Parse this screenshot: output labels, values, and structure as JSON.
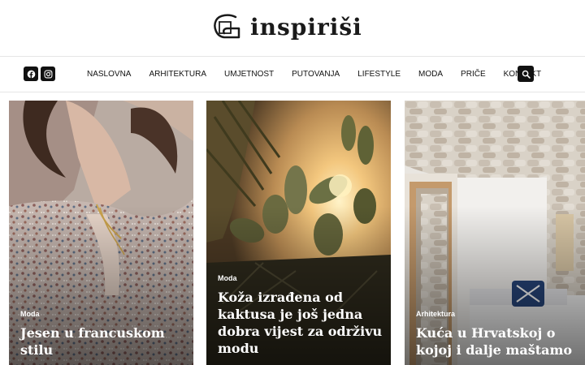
{
  "site": {
    "logo_text": "inspiriši"
  },
  "social": {
    "facebook_icon": "facebook-icon",
    "instagram_icon": "instagram-icon"
  },
  "nav": {
    "items": [
      {
        "label": "NASLOVNA"
      },
      {
        "label": "ARHITEKTURA"
      },
      {
        "label": "UMJETNOST"
      },
      {
        "label": "PUTOVANJA"
      },
      {
        "label": "LIFESTYLE"
      },
      {
        "label": "MODA"
      },
      {
        "label": "PRIČE"
      },
      {
        "label": "KONTAKT"
      }
    ],
    "search_icon": "search-icon"
  },
  "articles": [
    {
      "category": "Moda",
      "title": "Jesen u francuskom stilu"
    },
    {
      "category": "Moda",
      "title": "Koža izrađena od kaktusa je još jedna dobra vijest za održivu modu"
    },
    {
      "category": "Arhitektura",
      "title": "Kuća u Hrvatskoj o kojoj i dalje maštamo"
    }
  ],
  "colors": {
    "text": "#111111",
    "border": "#e6e6e6",
    "overlay_text": "#ffffff"
  }
}
